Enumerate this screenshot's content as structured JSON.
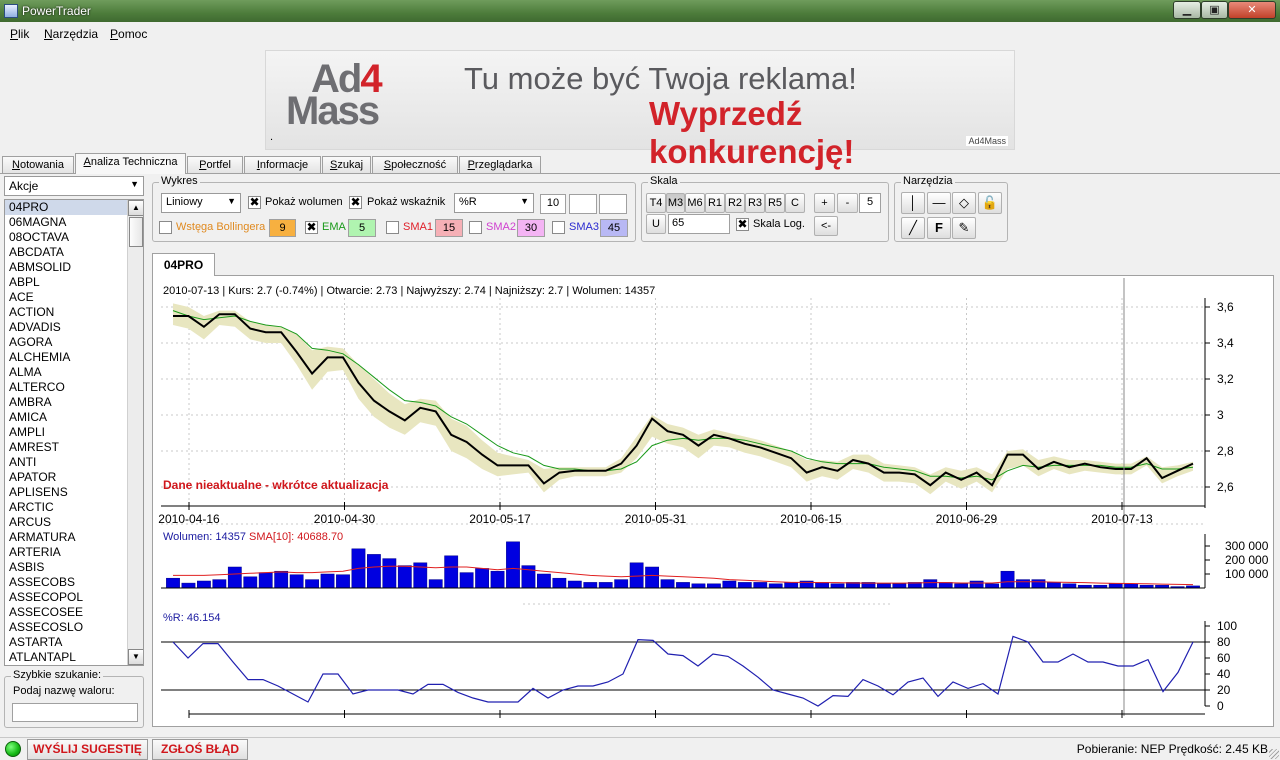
{
  "window": {
    "title": "PowerTrader"
  },
  "menu": [
    {
      "accel": "P",
      "rest": "lik"
    },
    {
      "accel": "N",
      "rest": "arzędzia"
    },
    {
      "accel": "P",
      "rest": "omoc"
    }
  ],
  "banner": {
    "logo_line1": "Ad",
    "logo_digit": "4",
    "logo_line2": "Mass",
    "headline": "Tu może być Twoja reklama!",
    "slogan": "Wyprzedź konkurencję!",
    "brand": "Ad4Mass",
    "dot": "."
  },
  "tabs": [
    {
      "accel": "N",
      "rest": "otowania",
      "active": false
    },
    {
      "accel": "A",
      "rest": "naliza Techniczna",
      "active": true
    },
    {
      "accel": "P",
      "rest": "ortfel",
      "active": false
    },
    {
      "accel": "I",
      "rest": "nformacje",
      "active": false
    },
    {
      "accel": "S",
      "rest": "zukaj",
      "active": false
    },
    {
      "accel": "S",
      "rest": "połeczność",
      "active": false
    },
    {
      "accel": "P",
      "rest": "rzeglądarka",
      "active": false
    }
  ],
  "sidebar": {
    "category": "Akcje",
    "items": [
      "04PRO",
      "06MAGNA",
      "08OCTAVA",
      "ABCDATA",
      "ABMSOLID",
      "ABPL",
      "ACE",
      "ACTION",
      "ADVADIS",
      "AGORA",
      "ALCHEMIA",
      "ALMA",
      "ALTERCO",
      "AMBRA",
      "AMICA",
      "AMPLI",
      "AMREST",
      "ANTI",
      "APATOR",
      "APLISENS",
      "ARCTIC",
      "ARCUS",
      "ARMATURA",
      "ARTERIA",
      "ASBIS",
      "ASSECOBS",
      "ASSECOPOL",
      "ASSECOSEE",
      "ASSECOSLO",
      "ASTARTA",
      "ATLANTAPL"
    ],
    "selected": "04PRO",
    "search_group": "Szybkie szukanie:",
    "search_label": "Podaj nazwę waloru:",
    "search_value": ""
  },
  "wykres": {
    "group": "Wykres",
    "type": "Liniowy",
    "show_volume": {
      "label": "Pokaż wolumen",
      "checked": true
    },
    "show_indicator": {
      "label": "Pokaż wskaźnik",
      "checked": true
    },
    "indicator": "%R",
    "param1": "10",
    "param2": "",
    "param3": "",
    "bollinger": {
      "label": "Wstęga Bollingera",
      "checked": false,
      "value": "9",
      "color": "#f0a830"
    },
    "ema": {
      "label": "EMA",
      "checked": true,
      "value": "5",
      "color": "#1a9a1a"
    },
    "sma1": {
      "label": "SMA1",
      "checked": false,
      "value": "15",
      "color": "#e0202a"
    },
    "sma2": {
      "label": "SMA2",
      "checked": false,
      "value": "30",
      "color": "#d040d0"
    },
    "sma3": {
      "label": "SMA3",
      "checked": false,
      "value": "45",
      "color": "#2a2ad0"
    }
  },
  "skala": {
    "group": "Skala",
    "buttons": [
      "T4",
      "M3",
      "M6",
      "R1",
      "R2",
      "R3",
      "R5",
      "C"
    ],
    "pressed": "M3",
    "plus": "+",
    "minus": "-",
    "zoom": "5",
    "u_label": "U",
    "u_value": "65",
    "log": {
      "label": "Skala Log.",
      "checked": true
    },
    "back": "<-"
  },
  "narzedzia": {
    "group": "Narzędzia"
  },
  "chart_tab": "04PRO",
  "chart_data": [
    {
      "type": "line",
      "info": "2010-07-13 | Kurs: 2.7 (-0.74%)  | Otwarcie: 2.73 | Najwyższy: 2.74 | Najniższy: 2.7 | Wolumen: 14357",
      "warning": "Dane nieaktualne - wkrótce aktualizacja",
      "x_labels": [
        "2010-04-16",
        "2010-04-30",
        "2010-05-17",
        "2010-05-31",
        "2010-06-15",
        "2010-06-29",
        "2010-07-13"
      ],
      "y_ticks": [
        "3,6",
        "3,4",
        "3,2",
        "3",
        "2,8",
        "2,6"
      ],
      "ylim": [
        2.55,
        3.65
      ],
      "close": [
        3.55,
        3.55,
        3.49,
        3.56,
        3.56,
        3.48,
        3.46,
        3.46,
        3.35,
        3.23,
        3.32,
        3.32,
        3.18,
        3.08,
        3.02,
        2.97,
        3.04,
        3.02,
        2.89,
        2.85,
        2.78,
        2.72,
        2.72,
        2.72,
        2.62,
        2.68,
        2.69,
        2.69,
        2.69,
        2.73,
        2.83,
        2.98,
        2.91,
        2.89,
        2.83,
        2.89,
        2.87,
        2.84,
        2.82,
        2.79,
        2.76,
        2.68,
        2.71,
        2.69,
        2.75,
        2.73,
        2.68,
        2.68,
        2.67,
        2.61,
        2.68,
        2.64,
        2.68,
        2.61,
        2.78,
        2.78,
        2.7,
        2.74,
        2.71,
        2.73,
        2.71,
        2.7,
        2.7,
        2.76,
        2.65,
        2.69,
        2.73
      ],
      "ema": [
        3.58,
        3.55,
        3.53,
        3.54,
        3.55,
        3.52,
        3.5,
        3.49,
        3.45,
        3.37,
        3.36,
        3.34,
        3.28,
        3.21,
        3.14,
        3.08,
        3.07,
        3.05,
        2.99,
        2.95,
        2.89,
        2.83,
        2.79,
        2.77,
        2.72,
        2.7,
        2.7,
        2.69,
        2.69,
        2.7,
        2.74,
        2.83,
        2.86,
        2.87,
        2.86,
        2.87,
        2.87,
        2.86,
        2.84,
        2.82,
        2.8,
        2.76,
        2.74,
        2.73,
        2.73,
        2.73,
        2.71,
        2.7,
        2.69,
        2.66,
        2.66,
        2.65,
        2.66,
        2.64,
        2.69,
        2.72,
        2.71,
        2.72,
        2.72,
        2.72,
        2.72,
        2.71,
        2.71,
        2.73,
        2.7,
        2.7,
        2.71
      ],
      "band_high": [
        3.62,
        3.6,
        3.55,
        3.58,
        3.58,
        3.52,
        3.5,
        3.49,
        3.45,
        3.36,
        3.38,
        3.37,
        3.28,
        3.2,
        3.12,
        3.06,
        3.09,
        3.08,
        2.98,
        2.94,
        2.86,
        2.79,
        2.77,
        2.75,
        2.7,
        2.71,
        2.71,
        2.71,
        2.71,
        2.76,
        2.88,
        3.0,
        2.95,
        2.93,
        2.89,
        2.92,
        2.9,
        2.88,
        2.86,
        2.83,
        2.8,
        2.75,
        2.75,
        2.74,
        2.78,
        2.78,
        2.73,
        2.72,
        2.71,
        2.67,
        2.71,
        2.69,
        2.71,
        2.67,
        2.8,
        2.81,
        2.75,
        2.77,
        2.75,
        2.75,
        2.74,
        2.73,
        2.73,
        2.77,
        2.71,
        2.72,
        2.74
      ],
      "band_low": [
        3.5,
        3.48,
        3.42,
        3.5,
        3.49,
        3.42,
        3.4,
        3.4,
        3.28,
        3.14,
        3.24,
        3.25,
        3.09,
        2.99,
        2.93,
        2.89,
        2.96,
        2.94,
        2.8,
        2.76,
        2.7,
        2.66,
        2.67,
        2.68,
        2.57,
        2.64,
        2.66,
        2.66,
        2.66,
        2.68,
        2.76,
        2.88,
        2.84,
        2.82,
        2.76,
        2.83,
        2.82,
        2.79,
        2.77,
        2.74,
        2.71,
        2.63,
        2.66,
        2.64,
        2.7,
        2.68,
        2.63,
        2.63,
        2.62,
        2.56,
        2.63,
        2.59,
        2.63,
        2.57,
        2.7,
        2.72,
        2.66,
        2.7,
        2.67,
        2.69,
        2.68,
        2.67,
        2.67,
        2.72,
        2.62,
        2.66,
        2.69
      ]
    },
    {
      "type": "bar",
      "info_volume": "Wolumen: 14357",
      "info_sma": "SMA[10]: 40688.70",
      "y_ticks": [
        "300 000",
        "200 000",
        "100 000"
      ],
      "ylim": [
        0,
        400000
      ],
      "values": [
        70000,
        35000,
        50000,
        60000,
        150000,
        80000,
        110000,
        120000,
        95000,
        60000,
        100000,
        95000,
        280000,
        240000,
        210000,
        160000,
        180000,
        60000,
        230000,
        110000,
        140000,
        120000,
        330000,
        160000,
        100000,
        70000,
        50000,
        40000,
        40000,
        60000,
        180000,
        150000,
        60000,
        40000,
        30000,
        30000,
        50000,
        40000,
        40000,
        30000,
        40000,
        50000,
        40000,
        30000,
        40000,
        40000,
        30000,
        30000,
        40000,
        60000,
        40000,
        30000,
        50000,
        30000,
        120000,
        60000,
        60000,
        40000,
        30000,
        20000,
        20000,
        30000,
        30000,
        20000,
        20000,
        10000,
        15000
      ],
      "sma": [
        90000,
        90000,
        90000,
        95000,
        100000,
        105000,
        110000,
        115000,
        110000,
        110000,
        115000,
        120000,
        140000,
        150000,
        155000,
        155000,
        150000,
        145000,
        150000,
        150000,
        140000,
        130000,
        140000,
        130000,
        120000,
        110000,
        100000,
        90000,
        85000,
        80000,
        85000,
        90000,
        85000,
        80000,
        75000,
        70000,
        60000,
        55000,
        50000,
        45000,
        40000,
        40000,
        38000,
        38000,
        36000,
        35000,
        35000,
        35000,
        36000,
        38000,
        38000,
        36000,
        36000,
        36000,
        45000,
        45000,
        45000,
        42000,
        40000,
        38000,
        35000,
        33000,
        32000,
        30000,
        28000,
        26000,
        24000
      ]
    },
    {
      "type": "line",
      "info": "%R: 46.154",
      "y_ticks": [
        "100",
        "80",
        "60",
        "40",
        "20",
        "0"
      ],
      "ylim": [
        0,
        100
      ],
      "levels": [
        80,
        20
      ],
      "values": [
        80,
        60,
        78,
        78,
        55,
        33,
        33,
        25,
        15,
        5,
        40,
        40,
        15,
        20,
        20,
        20,
        15,
        27,
        27,
        17,
        10,
        5,
        5,
        5,
        22,
        10,
        20,
        25,
        25,
        30,
        40,
        83,
        82,
        65,
        63,
        50,
        65,
        62,
        50,
        36,
        20,
        15,
        10,
        0,
        13,
        12,
        33,
        25,
        14,
        30,
        35,
        12,
        30,
        22,
        28,
        15,
        87,
        80,
        55,
        55,
        65,
        55,
        55,
        50,
        50,
        58,
        18,
        42,
        80
      ]
    }
  ],
  "status": {
    "btn_suggest": "WYŚLIJ SUGESTIĘ",
    "btn_report": "ZGŁOŚ BŁĄD",
    "right": "Pobieranie: NEP Prędkość: 2.45 KB"
  },
  "colors": {
    "price": "#000000",
    "ema": "#1a9a1a",
    "band": "#e8e6c0",
    "volume": "#0000e0",
    "sma": "#e02020",
    "wr": "#2020b0",
    "warning": "#d0161b"
  }
}
